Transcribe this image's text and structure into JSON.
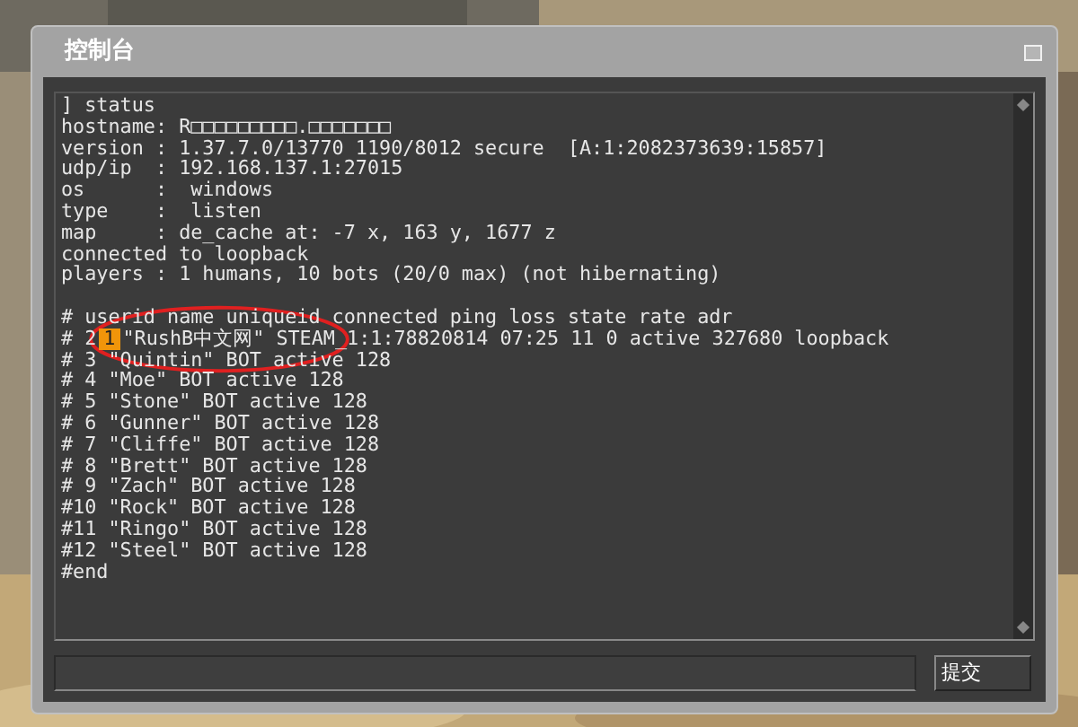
{
  "window": {
    "title": "控制台"
  },
  "console": {
    "lines": [
      {
        "kind": "text",
        "text": "] status"
      },
      {
        "kind": "text",
        "text": "hostname: R□□□□□□□□□.□□□□□□□"
      },
      {
        "kind": "text",
        "text": "version : 1.37.7.0/13770 1190/8012 secure  [A:1:2082373639:15857]"
      },
      {
        "kind": "text",
        "text": "udp/ip  : 192.168.137.1:27015"
      },
      {
        "kind": "text",
        "text": "os      :  windows"
      },
      {
        "kind": "text",
        "text": "type    :  listen"
      },
      {
        "kind": "text",
        "text": "map     : de_cache at: -7 x, 163 y, 1677 z"
      },
      {
        "kind": "text",
        "text": "connected to loopback"
      },
      {
        "kind": "text",
        "text": "players : 1 humans, 10 bots (20/0 max) (not hibernating)"
      },
      {
        "kind": "blank"
      },
      {
        "kind": "text",
        "text": "# userid name uniqueid connected ping loss state rate adr"
      },
      {
        "kind": "highlight",
        "prefix": "# 2",
        "highlight": "1",
        "rest": "\"RushB中文网\" STEAM_1:1:78820814 07:25 11 0 active 327680 loopback"
      },
      {
        "kind": "text",
        "text": "# 3 \"Quintin\" BOT active 128"
      },
      {
        "kind": "text",
        "text": "# 4 \"Moe\" BOT active 128"
      },
      {
        "kind": "text",
        "text": "# 5 \"Stone\" BOT active 128"
      },
      {
        "kind": "text",
        "text": "# 6 \"Gunner\" BOT active 128"
      },
      {
        "kind": "text",
        "text": "# 7 \"Cliffe\" BOT active 128"
      },
      {
        "kind": "text",
        "text": "# 8 \"Brett\" BOT active 128"
      },
      {
        "kind": "text",
        "text": "# 9 \"Zach\" BOT active 128"
      },
      {
        "kind": "text",
        "text": "#10 \"Rock\" BOT active 128"
      },
      {
        "kind": "text",
        "text": "#11 \"Ringo\" BOT active 128"
      },
      {
        "kind": "text",
        "text": "#12 \"Steel\" BOT active 128"
      },
      {
        "kind": "text",
        "text": "#end"
      }
    ]
  },
  "submit_button": {
    "label": "提交"
  }
}
